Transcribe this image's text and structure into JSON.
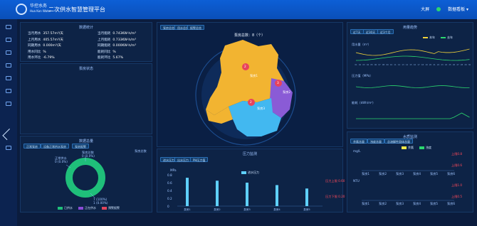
{
  "header": {
    "logo_cn": "华控水务",
    "logo_en": "Hua Kon Water",
    "title": "二次供水智慧管理平台",
    "user_label": "大屏",
    "menu_label": "数据看板 ▾"
  },
  "panels": {
    "stats_title": "数据统计",
    "map_label": "泵房总数：8（个）",
    "trend_title": "用量趋势",
    "status_title": "泵房状态",
    "pressure_title": "压力监测",
    "quality_title": "水质监测",
    "day_stats_title": "数据总量"
  },
  "stats": [
    {
      "label": "当月用水",
      "value": "357.57m³/天"
    },
    {
      "label": "当月能耗",
      "value": "0.743KW·h/m³"
    },
    {
      "label": "上月用水",
      "value": "405.57m³/天"
    },
    {
      "label": "上月能耗",
      "value": "0.733KW·h/m³"
    },
    {
      "label": "同期用水",
      "value": "0.000m³/天"
    },
    {
      "label": "同期能耗",
      "value": "0.000KW·h/m³"
    },
    {
      "label": "用水同比",
      "value": "%"
    },
    {
      "label": "能耗同比",
      "value": "%"
    },
    {
      "label": "用水环比",
      "value": "-6.79%"
    },
    {
      "label": "能耗环比",
      "value": "5.67%"
    }
  ],
  "status_buttons": [
    "正常泵房",
    "设备正常供水泵房",
    "泵房报警"
  ],
  "donut": {
    "chip": "泵房总数",
    "label_top": "泵房总数\n0 (0.0%)",
    "label_left": "正常供水\n0 (0.0%)",
    "label_bottom": "7 (100%)\n1 (0.00%)",
    "legend": [
      {
        "name": "已供水",
        "color": "#1fbf7a"
      },
      {
        "name": "正在供水",
        "color": "#8a4bd6"
      },
      {
        "name": "预警报警",
        "color": "#e0455c"
      }
    ]
  },
  "map": {
    "buttons": [
      "泵房总览",
      "用水总览",
      "报警总览"
    ],
    "markers": [
      {
        "num": "2",
        "name": "泵房1"
      },
      {
        "num": "3",
        "name": "泵房2"
      },
      {
        "name": "泵房3",
        "num": "2"
      }
    ],
    "areas": [
      {
        "name": "north",
        "color": "#f2b431"
      },
      {
        "name": "east",
        "color": "#8a5bd6"
      },
      {
        "name": "south",
        "color": "#42b8f0"
      },
      {
        "name": "southwest",
        "color": "#f2b431"
      }
    ]
  },
  "trend": {
    "buttons": [
      "近7天",
      "近30天",
      "近3个月"
    ],
    "legend": [
      "本年",
      "去年"
    ],
    "ylabel_water": "用水量（m³）",
    "ylabel_pressure": "压力值（MPa）",
    "ylabel_energy": "能耗（kWh/m³）",
    "x_labels": [
      "01",
      "02",
      "03",
      "04",
      "05",
      "06",
      "07",
      "08",
      "09",
      "10",
      "11",
      "12",
      "13",
      "14",
      "15",
      "16",
      "17",
      "18",
      "19",
      "20",
      "21",
      "22",
      "23",
      "24",
      "25",
      "26",
      "27",
      "28",
      "29",
      "30"
    ]
  },
  "pressure": {
    "buttons": [
      "进水压力",
      "出水压力",
      "PH压力值"
    ],
    "legend": "进水压力",
    "unit": "MPa",
    "y_ticks": [
      "0.8",
      "0.6",
      "0.4",
      "0.2",
      "0"
    ],
    "bars": [
      {
        "name": "泵房1",
        "value": 0.58
      },
      {
        "name": "泵房2",
        "value": 0.52
      },
      {
        "name": "泵房3",
        "value": 0.48
      },
      {
        "name": "泵房4",
        "value": 0.43
      },
      {
        "name": "泵房5",
        "value": 0.36
      }
    ],
    "right_note_1": "压力上限 0.60",
    "right_note_2": "压力下限 0.20"
  },
  "quality": {
    "buttons": [
      "余氯含量",
      "浊度含量",
      "总溶解性固体含量"
    ],
    "legend": [
      "余氯",
      "浊度"
    ],
    "unit1": "mg/L",
    "unit2": "NTU",
    "warn_1": "上限0.8",
    "warn_2": "上限0.6",
    "warn_3": "上限1.0",
    "warn_4": "上限0.5",
    "labels_top": [
      "泵房1",
      "泵房2",
      "泵房3",
      "泵房4",
      "泵房5",
      "泵房6"
    ],
    "labels_bottom": [
      "泵房1",
      "泵房2",
      "泵房3",
      "泵房4",
      "泵房5",
      "泵房6"
    ]
  },
  "stats_chip": "数据汇总",
  "colors": {
    "accent": "#0d5fd6",
    "panel": "#0d2346",
    "green": "#2bd66f",
    "yellow": "#f2d33a",
    "bar": "#5fd0ff"
  }
}
